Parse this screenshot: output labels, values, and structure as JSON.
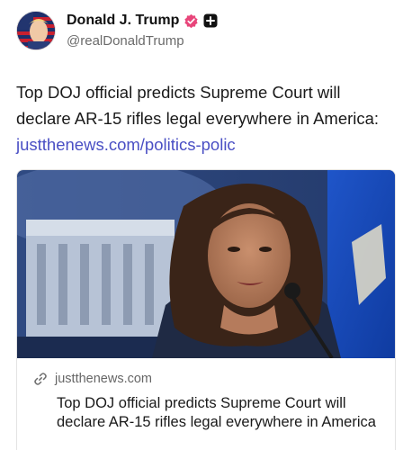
{
  "author": {
    "display_name": "Donald J. Trump",
    "handle": "@realDonaldTrump",
    "avatar_icon": "flag-portrait-avatar",
    "verified_icon": "verified-badge-icon",
    "add_icon": "plus-square-icon"
  },
  "post": {
    "text": "Top DOJ official predicts Supreme Court will declare AR-15 rifles legal everywhere in America: ",
    "link_text": "justthenews.com/politics-polic",
    "link_color": "#4a4fc4"
  },
  "link_card": {
    "image_icon": "news-photo",
    "domain_icon": "link-icon",
    "domain": "justthenews.com",
    "title": "Top DOJ official predicts Supreme Court will declare AR-15 rifles legal everywhere in America"
  },
  "colors": {
    "accent_badge": "#e8457a",
    "text": "#1a1a1a",
    "muted": "#6b6b6b"
  }
}
